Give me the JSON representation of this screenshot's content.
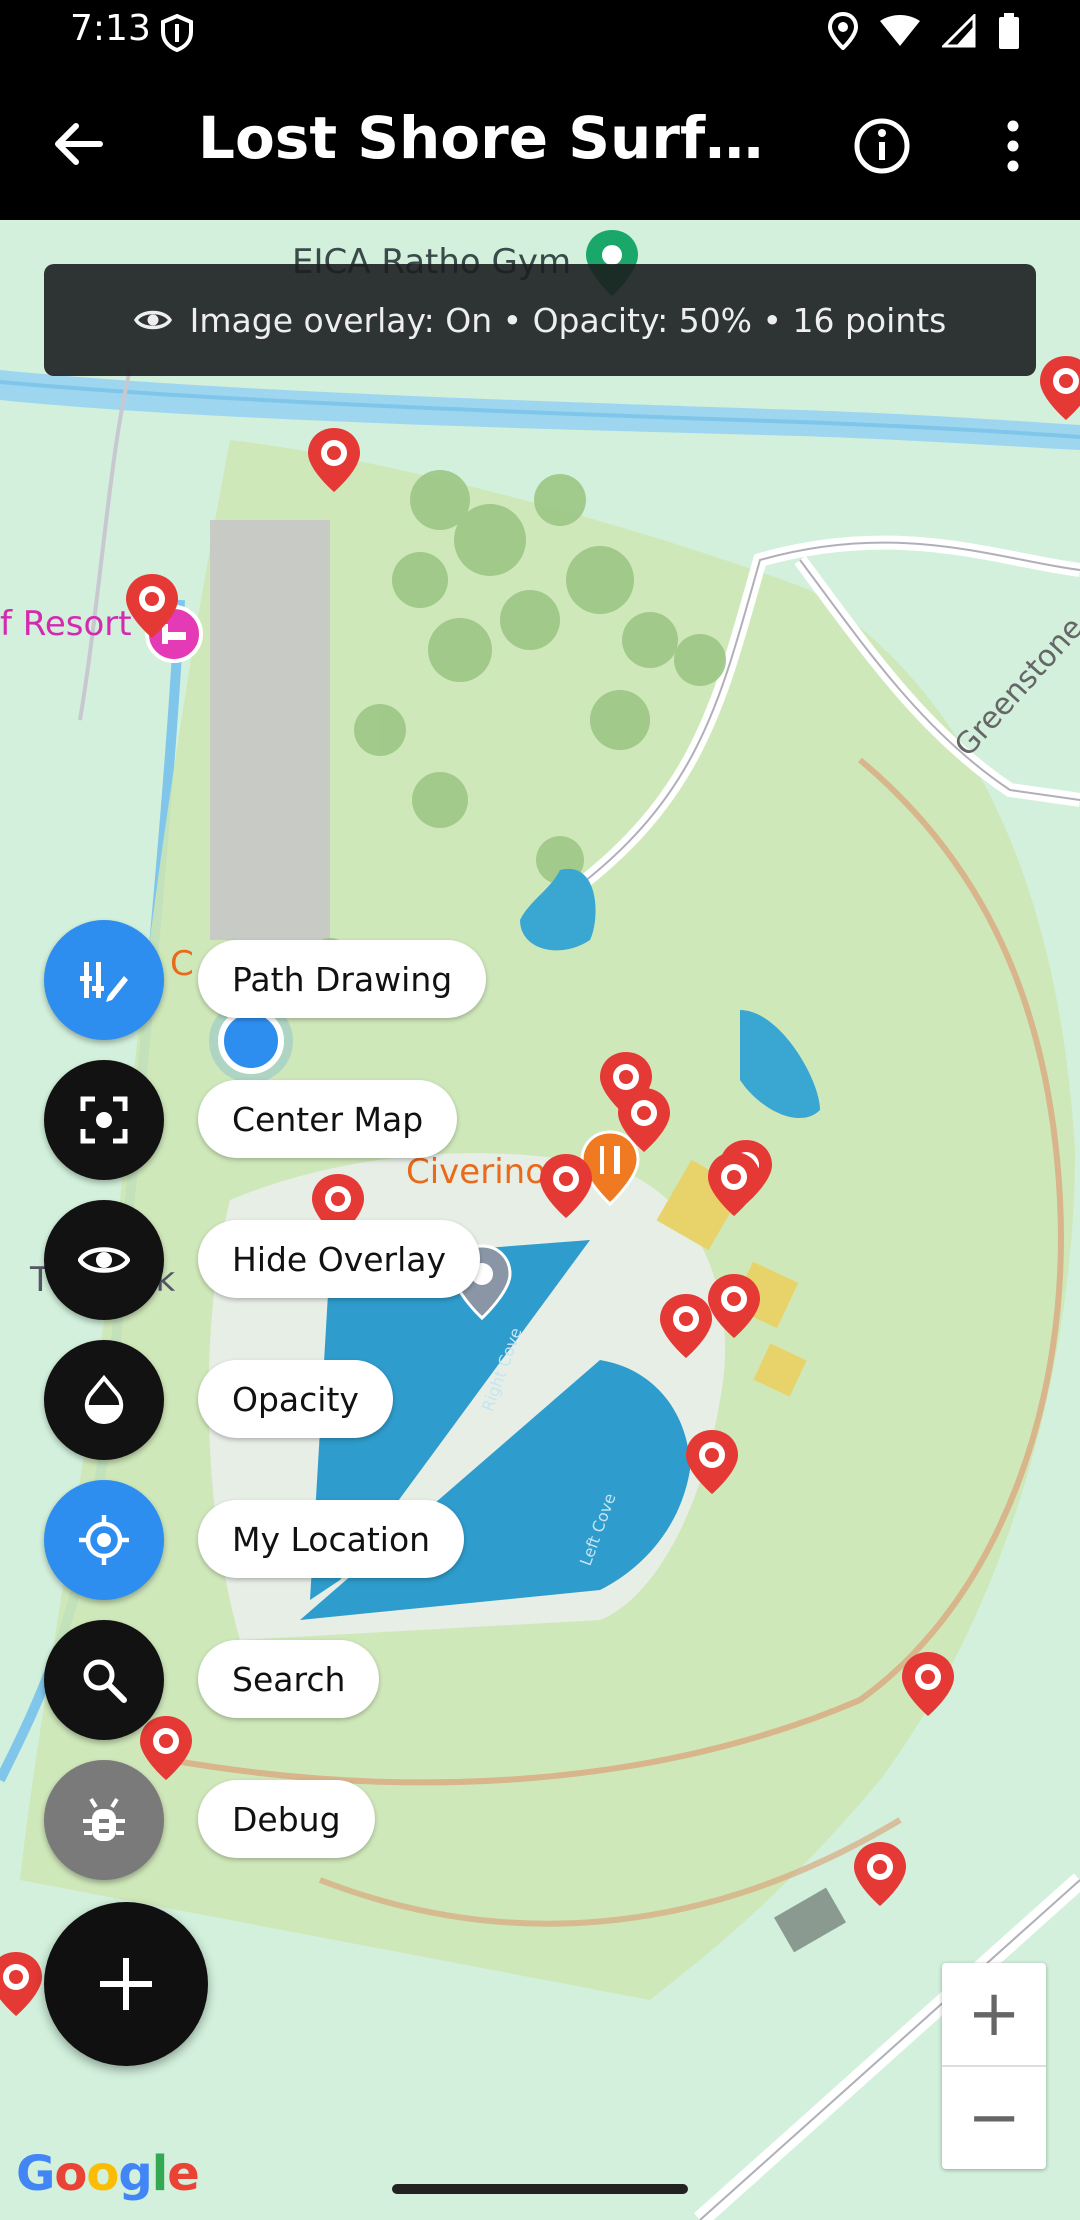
{
  "status_bar": {
    "time": "7:13"
  },
  "app_bar": {
    "title": "Lost Shore Surf R..."
  },
  "map": {
    "banner_text": "Image overlay: On • Opacity: 50% • 16 points",
    "labels": {
      "gym": "EICA Ratho Gym",
      "resort": "f Resort",
      "restaurant": "Civerinos",
      "road": "Greenstone",
      "partial_c": "C",
      "partial_t": "T",
      "partial_fsk": "fSk",
      "right_cove": "Right Cove",
      "left_cove": "Left Cove"
    }
  },
  "fab_menu": [
    {
      "label": "Path Drawing",
      "icon": "path-drawing-icon",
      "color": "blue"
    },
    {
      "label": "Center Map",
      "icon": "center-focus-icon",
      "color": "dark"
    },
    {
      "label": "Hide Overlay",
      "icon": "eye-icon",
      "color": "dark"
    },
    {
      "label": "Opacity",
      "icon": "opacity-drop-icon",
      "color": "dark"
    },
    {
      "label": "My Location",
      "icon": "location-target-icon",
      "color": "blue"
    },
    {
      "label": "Search",
      "icon": "search-icon",
      "color": "dark"
    },
    {
      "label": "Debug",
      "icon": "bug-icon",
      "color": "grey"
    }
  ],
  "zoom": {
    "in": "+",
    "out": "−"
  },
  "attribution": "Google",
  "colors": {
    "accent_blue": "#2e8ef0",
    "marker_red": "#e53935",
    "water": "#3aa6d2",
    "park": "#cfe6b4"
  }
}
